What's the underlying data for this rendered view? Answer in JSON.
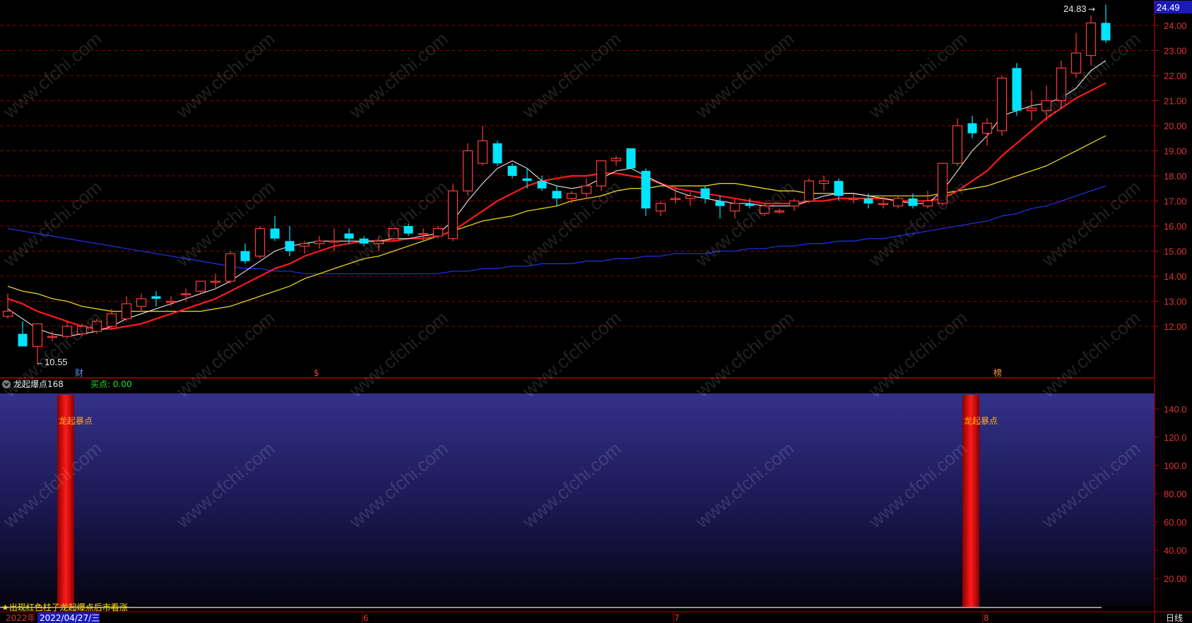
{
  "price_axis": {
    "ticks": [
      "24.00",
      "23.00",
      "22.00",
      "21.00",
      "20.00",
      "19.00",
      "18.00",
      "17.00",
      "16.00",
      "15.00",
      "14.00",
      "13.00",
      "12.00"
    ],
    "last_price": "24.49"
  },
  "main_annotations": {
    "high_label": "24.83",
    "low_label": "←10.55",
    "event_markers": [
      "财",
      "$",
      "榜"
    ]
  },
  "indicator": {
    "name": "龙起爆点168",
    "buy_label": "买点: 0.00",
    "signal_label": "龙起暴点",
    "note": "★出现红色柱子龙起爆点后市看涨",
    "ticks": [
      "140.0",
      "120.0",
      "100.0",
      "80.00",
      "60.00",
      "40.00",
      "20.00"
    ]
  },
  "time_axis": {
    "year": "2022年",
    "cursor_date": "2022/04/27/三",
    "months": [
      "6",
      "7",
      "8"
    ],
    "period": "日线"
  },
  "watermark": "www.cfchi.com",
  "colors": {
    "up": "#ff3b3b",
    "down": "#00e5ff",
    "ma5": "#e8e8e8",
    "ma10": "#ff1a1a",
    "ma20": "#e3d21b",
    "ma60": "#1e2fd6",
    "panel_divider": "#b00000",
    "grid": "#8a0000"
  },
  "chart_data": {
    "type": "candlestick",
    "ylim": [
      10.0,
      25.0
    ],
    "candles": [
      [
        12.4,
        13.3,
        12.3,
        12.6
      ],
      [
        11.7,
        12.2,
        11.2,
        11.2
      ],
      [
        11.2,
        11.7,
        10.55,
        12.1
      ],
      [
        11.6,
        11.8,
        11.4,
        11.6
      ],
      [
        11.6,
        12.2,
        11.5,
        12.0
      ],
      [
        11.7,
        12.1,
        11.6,
        12.0
      ],
      [
        11.8,
        12.3,
        11.7,
        12.2
      ],
      [
        12.0,
        12.7,
        11.9,
        12.5
      ],
      [
        12.3,
        13.2,
        12.2,
        12.9
      ],
      [
        12.8,
        13.3,
        12.6,
        13.1
      ],
      [
        13.2,
        13.4,
        12.8,
        13.1
      ],
      [
        13.0,
        13.2,
        12.8,
        13.0
      ],
      [
        13.3,
        13.5,
        13.0,
        13.3
      ],
      [
        13.4,
        13.8,
        13.3,
        13.8
      ],
      [
        13.8,
        14.1,
        13.5,
        13.8
      ],
      [
        13.8,
        15.0,
        13.7,
        14.9
      ],
      [
        15.0,
        15.3,
        14.5,
        14.6
      ],
      [
        14.8,
        16.0,
        14.7,
        15.9
      ],
      [
        15.9,
        16.4,
        15.4,
        15.5
      ],
      [
        15.4,
        16.0,
        14.8,
        15.0
      ],
      [
        15.2,
        15.4,
        14.9,
        15.3
      ],
      [
        15.3,
        15.6,
        15.1,
        15.4
      ],
      [
        15.4,
        15.9,
        15.0,
        15.4
      ],
      [
        15.7,
        15.9,
        15.3,
        15.5
      ],
      [
        15.5,
        15.6,
        15.2,
        15.3
      ],
      [
        15.3,
        15.6,
        15.0,
        15.4
      ],
      [
        15.5,
        15.9,
        15.4,
        15.9
      ],
      [
        16.0,
        16.1,
        15.6,
        15.7
      ],
      [
        15.7,
        15.9,
        15.4,
        15.7
      ],
      [
        15.6,
        16.0,
        15.5,
        15.9
      ],
      [
        15.5,
        17.7,
        15.4,
        17.4
      ],
      [
        17.4,
        19.3,
        17.2,
        19.0
      ],
      [
        18.5,
        20.0,
        18.4,
        19.4
      ],
      [
        19.3,
        19.4,
        18.4,
        18.5
      ],
      [
        18.4,
        18.5,
        17.9,
        18.0
      ],
      [
        17.9,
        18.3,
        17.5,
        17.8
      ],
      [
        17.8,
        18.0,
        17.4,
        17.5
      ],
      [
        17.4,
        17.6,
        16.8,
        17.1
      ],
      [
        17.1,
        17.4,
        16.9,
        17.3
      ],
      [
        17.3,
        17.9,
        17.1,
        17.6
      ],
      [
        17.6,
        18.6,
        17.4,
        18.6
      ],
      [
        18.6,
        18.8,
        18.4,
        18.7
      ],
      [
        19.1,
        19.1,
        18.3,
        18.3
      ],
      [
        18.2,
        18.3,
        16.4,
        16.7
      ],
      [
        16.6,
        17.0,
        16.4,
        16.9
      ],
      [
        17.1,
        17.6,
        16.9,
        17.1
      ],
      [
        17.1,
        17.4,
        16.8,
        17.2
      ],
      [
        17.5,
        17.6,
        16.9,
        17.1
      ],
      [
        17.0,
        17.2,
        16.3,
        16.8
      ],
      [
        16.6,
        17.1,
        16.3,
        16.9
      ],
      [
        16.9,
        17.1,
        16.7,
        16.8
      ],
      [
        16.5,
        16.9,
        16.4,
        16.8
      ],
      [
        16.6,
        16.7,
        16.5,
        16.6
      ],
      [
        16.8,
        17.1,
        16.6,
        17.0
      ],
      [
        17.0,
        17.9,
        16.9,
        17.8
      ],
      [
        17.7,
        18.0,
        17.4,
        17.8
      ],
      [
        17.8,
        17.9,
        17.0,
        17.2
      ],
      [
        17.1,
        17.3,
        16.9,
        17.1
      ],
      [
        17.1,
        17.3,
        16.7,
        16.9
      ],
      [
        16.9,
        17.2,
        16.7,
        16.9
      ],
      [
        16.8,
        17.2,
        16.7,
        17.1
      ],
      [
        17.1,
        17.3,
        16.7,
        16.8
      ],
      [
        16.8,
        17.4,
        16.7,
        17.0
      ],
      [
        16.9,
        18.5,
        16.8,
        18.5
      ],
      [
        18.5,
        20.3,
        18.4,
        20.0
      ],
      [
        20.1,
        20.4,
        19.5,
        19.7
      ],
      [
        19.7,
        20.3,
        19.2,
        20.1
      ],
      [
        19.8,
        22.0,
        19.6,
        21.9
      ],
      [
        22.3,
        22.5,
        20.4,
        20.6
      ],
      [
        20.6,
        21.4,
        20.2,
        20.7
      ],
      [
        20.6,
        21.6,
        20.2,
        21.0
      ],
      [
        21.0,
        22.6,
        20.7,
        22.3
      ],
      [
        22.1,
        23.7,
        21.9,
        22.9
      ],
      [
        22.8,
        24.4,
        22.4,
        24.1
      ],
      [
        24.1,
        24.83,
        23.3,
        23.4
      ]
    ],
    "ma5": [
      12.7,
      12.3,
      11.9,
      11.7,
      11.6,
      11.7,
      11.8,
      12.0,
      12.3,
      12.5,
      12.7,
      12.9,
      13.1,
      13.3,
      13.5,
      13.8,
      14.2,
      14.6,
      15.0,
      15.2,
      15.3,
      15.4,
      15.4,
      15.4,
      15.4,
      15.4,
      15.5,
      15.5,
      15.6,
      15.7,
      16.2,
      17.0,
      17.7,
      18.3,
      18.6,
      18.3,
      17.8,
      17.6,
      17.5,
      17.6,
      17.9,
      18.2,
      18.3,
      18.0,
      17.7,
      17.4,
      17.2,
      17.1,
      17.0,
      16.9,
      16.9,
      16.8,
      16.8,
      16.8,
      17.0,
      17.2,
      17.3,
      17.3,
      17.2,
      17.1,
      17.0,
      16.9,
      16.9,
      17.4,
      18.2,
      19.0,
      19.6,
      20.4,
      20.6,
      20.8,
      20.9,
      21.1,
      21.5,
      22.2,
      22.6
    ],
    "ma10": [
      13.1,
      12.9,
      12.6,
      12.4,
      12.2,
      12.0,
      11.9,
      11.9,
      12.0,
      12.1,
      12.3,
      12.5,
      12.7,
      12.9,
      13.1,
      13.4,
      13.7,
      14.0,
      14.3,
      14.5,
      14.8,
      15.0,
      15.2,
      15.3,
      15.4,
      15.4,
      15.4,
      15.5,
      15.5,
      15.6,
      15.8,
      16.2,
      16.6,
      17.0,
      17.3,
      17.6,
      17.8,
      17.9,
      18.0,
      18.0,
      18.1,
      18.1,
      18.0,
      17.9,
      17.7,
      17.5,
      17.4,
      17.3,
      17.2,
      17.1,
      17.0,
      16.9,
      16.9,
      16.9,
      17.0,
      17.0,
      17.1,
      17.1,
      17.1,
      17.1,
      17.0,
      17.0,
      17.0,
      17.1,
      17.4,
      17.8,
      18.2,
      18.8,
      19.3,
      19.8,
      20.3,
      20.7,
      21.1,
      21.4,
      21.7
    ],
    "ma20": [
      13.6,
      13.4,
      13.3,
      13.1,
      13.0,
      12.8,
      12.7,
      12.6,
      12.6,
      12.6,
      12.6,
      12.6,
      12.6,
      12.6,
      12.7,
      12.8,
      13.0,
      13.2,
      13.4,
      13.6,
      13.9,
      14.1,
      14.3,
      14.5,
      14.7,
      14.8,
      15.0,
      15.2,
      15.4,
      15.6,
      15.8,
      16.0,
      16.2,
      16.3,
      16.4,
      16.6,
      16.7,
      16.8,
      17.0,
      17.1,
      17.2,
      17.4,
      17.5,
      17.5,
      17.6,
      17.6,
      17.6,
      17.6,
      17.7,
      17.7,
      17.6,
      17.5,
      17.4,
      17.4,
      17.3,
      17.3,
      17.3,
      17.3,
      17.2,
      17.2,
      17.2,
      17.2,
      17.2,
      17.3,
      17.4,
      17.5,
      17.6,
      17.8,
      18.0,
      18.2,
      18.4,
      18.7,
      19.0,
      19.3,
      19.6
    ],
    "ma60": [
      15.9,
      15.8,
      15.7,
      15.6,
      15.5,
      15.4,
      15.3,
      15.2,
      15.1,
      15.0,
      14.9,
      14.8,
      14.7,
      14.6,
      14.5,
      14.4,
      14.3,
      14.3,
      14.2,
      14.2,
      14.1,
      14.1,
      14.1,
      14.1,
      14.1,
      14.1,
      14.1,
      14.1,
      14.1,
      14.1,
      14.2,
      14.2,
      14.3,
      14.3,
      14.4,
      14.4,
      14.5,
      14.5,
      14.5,
      14.6,
      14.6,
      14.7,
      14.7,
      14.8,
      14.8,
      14.9,
      14.9,
      14.9,
      15.0,
      15.0,
      15.1,
      15.1,
      15.2,
      15.2,
      15.3,
      15.3,
      15.4,
      15.4,
      15.5,
      15.5,
      15.6,
      15.7,
      15.8,
      15.9,
      16.0,
      16.1,
      16.2,
      16.4,
      16.5,
      16.7,
      16.8,
      17.0,
      17.2,
      17.4,
      17.6
    ],
    "signals": [
      2,
      63
    ],
    "signal_value": 150
  }
}
